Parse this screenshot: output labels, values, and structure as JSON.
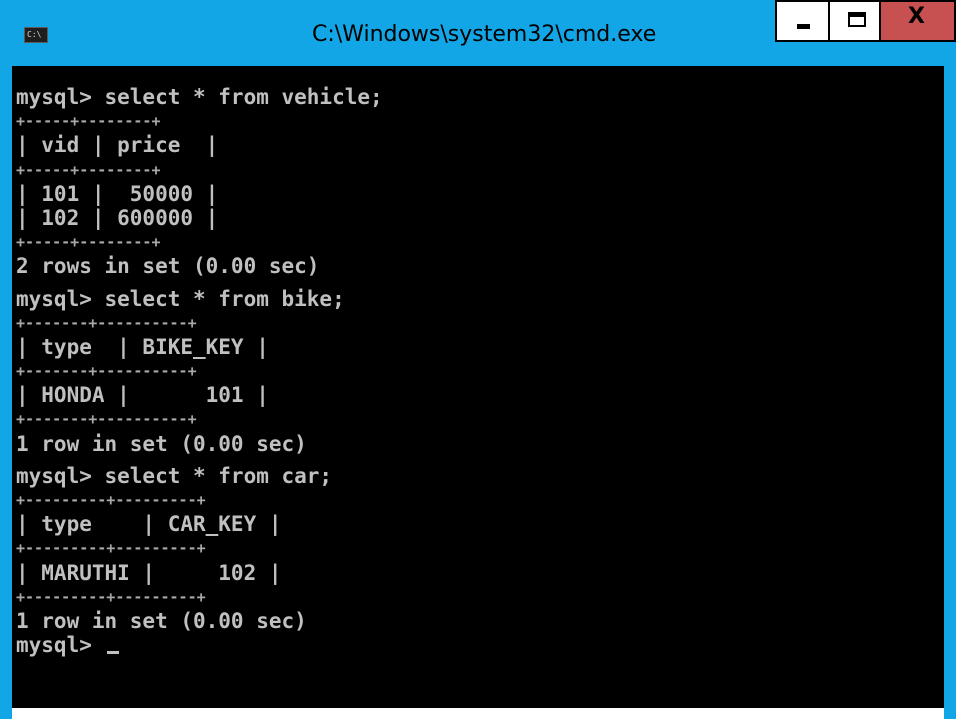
{
  "window": {
    "title": "C:\\Windows\\system32\\cmd.exe",
    "app_icon_text": "C:\\",
    "close_glyph": "X"
  },
  "console": {
    "lines": [
      {
        "kind": "cmd",
        "text": "mysql> select * from vehicle;"
      },
      {
        "kind": "sep",
        "text": "+-----+--------+"
      },
      {
        "kind": "row",
        "text": "| vid | price  |"
      },
      {
        "kind": "sep",
        "text": "+-----+--------+"
      },
      {
        "kind": "row",
        "text": "| 101 |  50000 |"
      },
      {
        "kind": "row",
        "text": "| 102 | 600000 |"
      },
      {
        "kind": "sep",
        "text": "+-----+--------+"
      },
      {
        "kind": "info",
        "text": "2 rows in set (0.00 sec)"
      },
      {
        "kind": "cmd",
        "text": "mysql> select * from bike;"
      },
      {
        "kind": "sep",
        "text": "+-------+----------+"
      },
      {
        "kind": "row",
        "text": "| type  | BIKE_KEY |"
      },
      {
        "kind": "sep",
        "text": "+-------+----------+"
      },
      {
        "kind": "row",
        "text": "| HONDA |      101 |"
      },
      {
        "kind": "sep",
        "text": "+-------+----------+"
      },
      {
        "kind": "info",
        "text": "1 row in set (0.00 sec)"
      },
      {
        "kind": "cmd",
        "text": "mysql> select * from car;"
      },
      {
        "kind": "sep",
        "text": "+---------+---------+"
      },
      {
        "kind": "row",
        "text": "| type    | CAR_KEY |"
      },
      {
        "kind": "sep",
        "text": "+---------+---------+"
      },
      {
        "kind": "row",
        "text": "| MARUTHI |     102 |"
      },
      {
        "kind": "sep",
        "text": "+---------+---------+"
      },
      {
        "kind": "info",
        "text": "1 row in set (0.00 sec)"
      },
      {
        "kind": "prompt",
        "text": "mysql> "
      }
    ]
  },
  "colors": {
    "title_bar": "#12a6e6",
    "console_bg": "#000000",
    "console_text": "#c0c0c0",
    "close_button": "#c75050"
  }
}
